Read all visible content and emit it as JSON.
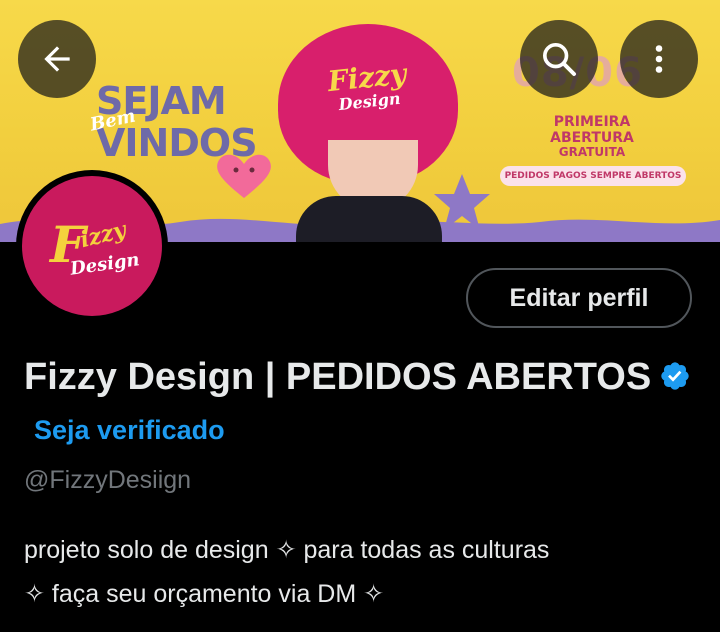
{
  "banner": {
    "welcome_line1": "SEJAM",
    "welcome_script": "Bem",
    "welcome_line2": "VINDOS",
    "hat_logo_title": "Fizzy",
    "hat_logo_subtitle": "Design",
    "date_text": "08/06",
    "headline": "PRIMEIRA ABERTURA",
    "subheadline": "GRATUITA",
    "pill_text": "PEDIDOS PAGOS SEMPRE ABERTOS"
  },
  "avatar": {
    "logo_initial": "F",
    "logo_rest": "izzy",
    "logo_sub": "Design"
  },
  "actions": {
    "edit_profile_label": "Editar perfil"
  },
  "profile": {
    "display_name": "Fizzy Design | PEDIDOS ABERTOS",
    "verify_link": "Seja verificado",
    "handle": "@FizzyDesiign",
    "bio_line1": "projeto solo de design ✧ para todas as culturas",
    "bio_line2": "✧ faça seu orçamento via DM ✧"
  },
  "icons": {
    "back": "arrow-left-icon",
    "search": "search-icon",
    "more": "more-vertical-icon",
    "verified": "verified-badge-icon"
  },
  "colors": {
    "accent": "#1d9bf0",
    "text_primary": "#e7e9ea",
    "text_secondary": "#71767b",
    "background": "#000000",
    "brand_pink": "#c91a5d",
    "brand_yellow": "#f4d23d"
  }
}
